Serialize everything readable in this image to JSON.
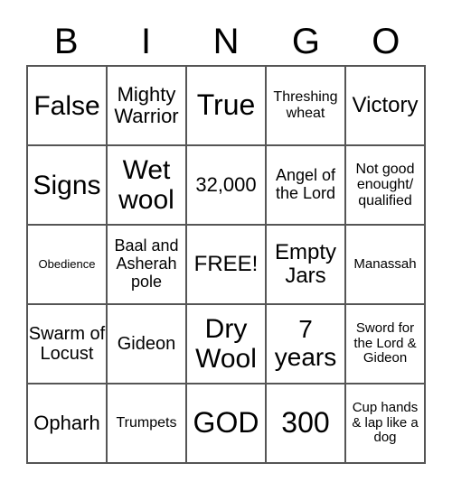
{
  "header": [
    "B",
    "I",
    "N",
    "G",
    "O"
  ],
  "cells": [
    [
      "False",
      "Mighty Warrior",
      "True",
      "Threshing wheat",
      "Victory"
    ],
    [
      "Signs",
      "Wet wool",
      "32,000",
      "Angel of the Lord",
      "Not good enought/ qualified"
    ],
    [
      "Obedience",
      "Baal and Asherah pole",
      "FREE!",
      "Empty Jars",
      "Manassah"
    ],
    [
      "Swarm of Locust",
      "Gideon",
      "Dry Wool",
      "7 years",
      "Sword for the Lord & Gideon"
    ],
    [
      "Opharh",
      "Trumpets",
      "GOD",
      "300",
      "Cup hands & lap like a dog"
    ]
  ]
}
